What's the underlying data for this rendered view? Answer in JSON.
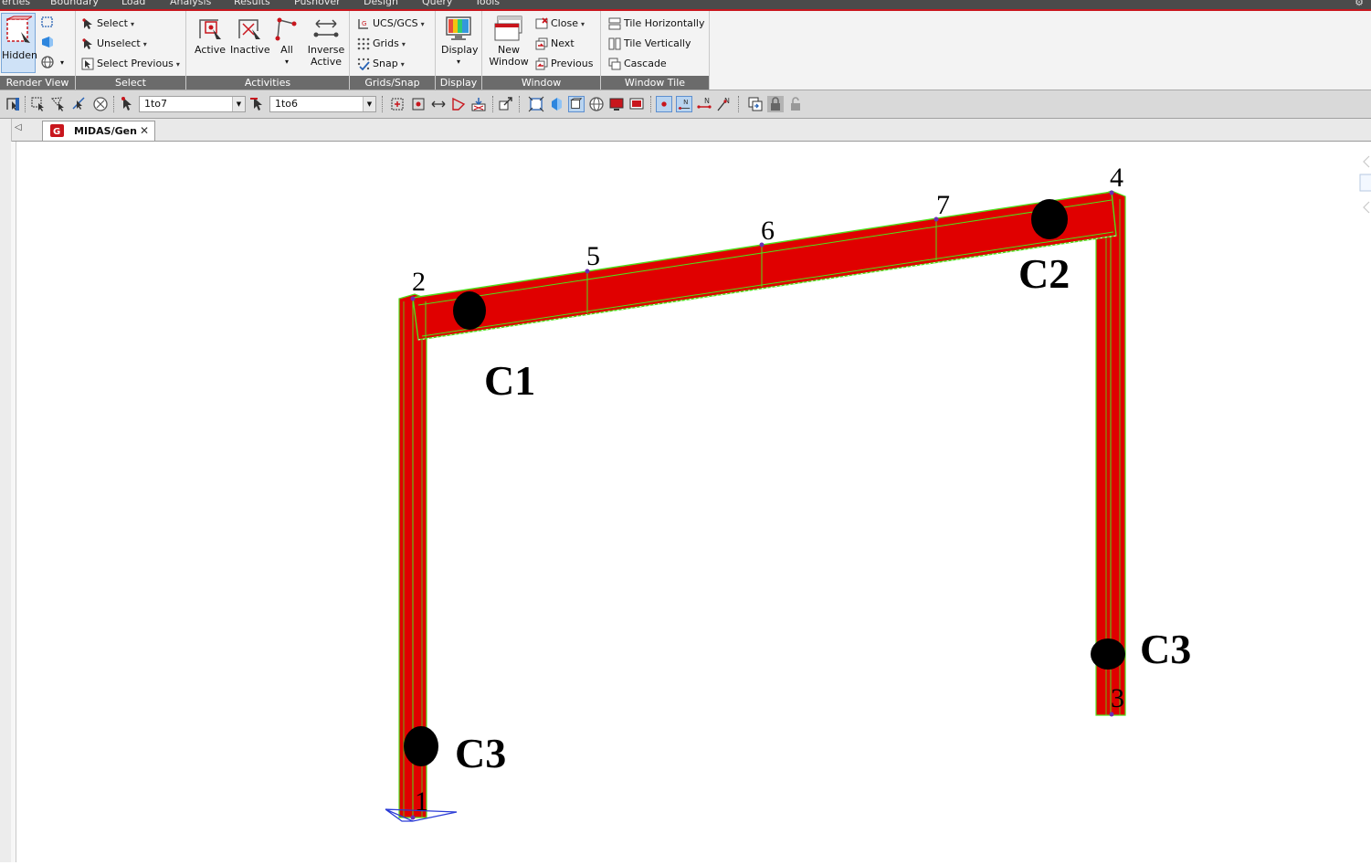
{
  "menubar": {
    "items": [
      "erties",
      "Boundary",
      "Load",
      "Analysis",
      "Results",
      "Pushover",
      "Design",
      "Query",
      "Tools"
    ]
  },
  "ribbon": {
    "render_view": {
      "title": "Render View",
      "hidden_label": "Hidden"
    },
    "select": {
      "title": "Select",
      "select_label": "Select",
      "unselect_label": "Unselect",
      "select_previous_label": "Select Previous"
    },
    "activities": {
      "title": "Activities",
      "active_label": "Active",
      "inactive_label": "Inactive",
      "all_label": "All",
      "inverse_active_label_1": "Inverse",
      "inverse_active_label_2": "Active"
    },
    "grids_snap": {
      "title": "Grids/Snap",
      "ucs_label": "UCS/GCS",
      "grids_label": "Grids",
      "snap_label": "Snap"
    },
    "display": {
      "title": "Display",
      "display_label": "Display"
    },
    "window": {
      "title": "Window",
      "new_window_label_1": "New",
      "new_window_label_2": "Window",
      "close_label": "Close",
      "next_label": "Next",
      "previous_label": "Previous"
    },
    "window_tile": {
      "title": "Window Tile",
      "tile_h_label": "Tile Horizontally",
      "tile_v_label": "Tile Vertically",
      "cascade_label": "Cascade"
    }
  },
  "toolbar": {
    "node_combo_value": "1to7",
    "element_combo_value": "1to6"
  },
  "tabs": {
    "doc_tab_label": "MIDAS/Gen"
  },
  "model": {
    "node_labels": [
      "1",
      "2",
      "3",
      "4",
      "5",
      "6",
      "7"
    ],
    "connection_labels": {
      "c1": "C1",
      "c2": "C2",
      "c3_left": "C3",
      "c3_right": "C3"
    },
    "colors": {
      "member_fill": "#e00000",
      "member_edge": "#4fe01c",
      "hinge": "#000000",
      "node": "#6a2fb3",
      "support": "#2a3bd6"
    }
  }
}
